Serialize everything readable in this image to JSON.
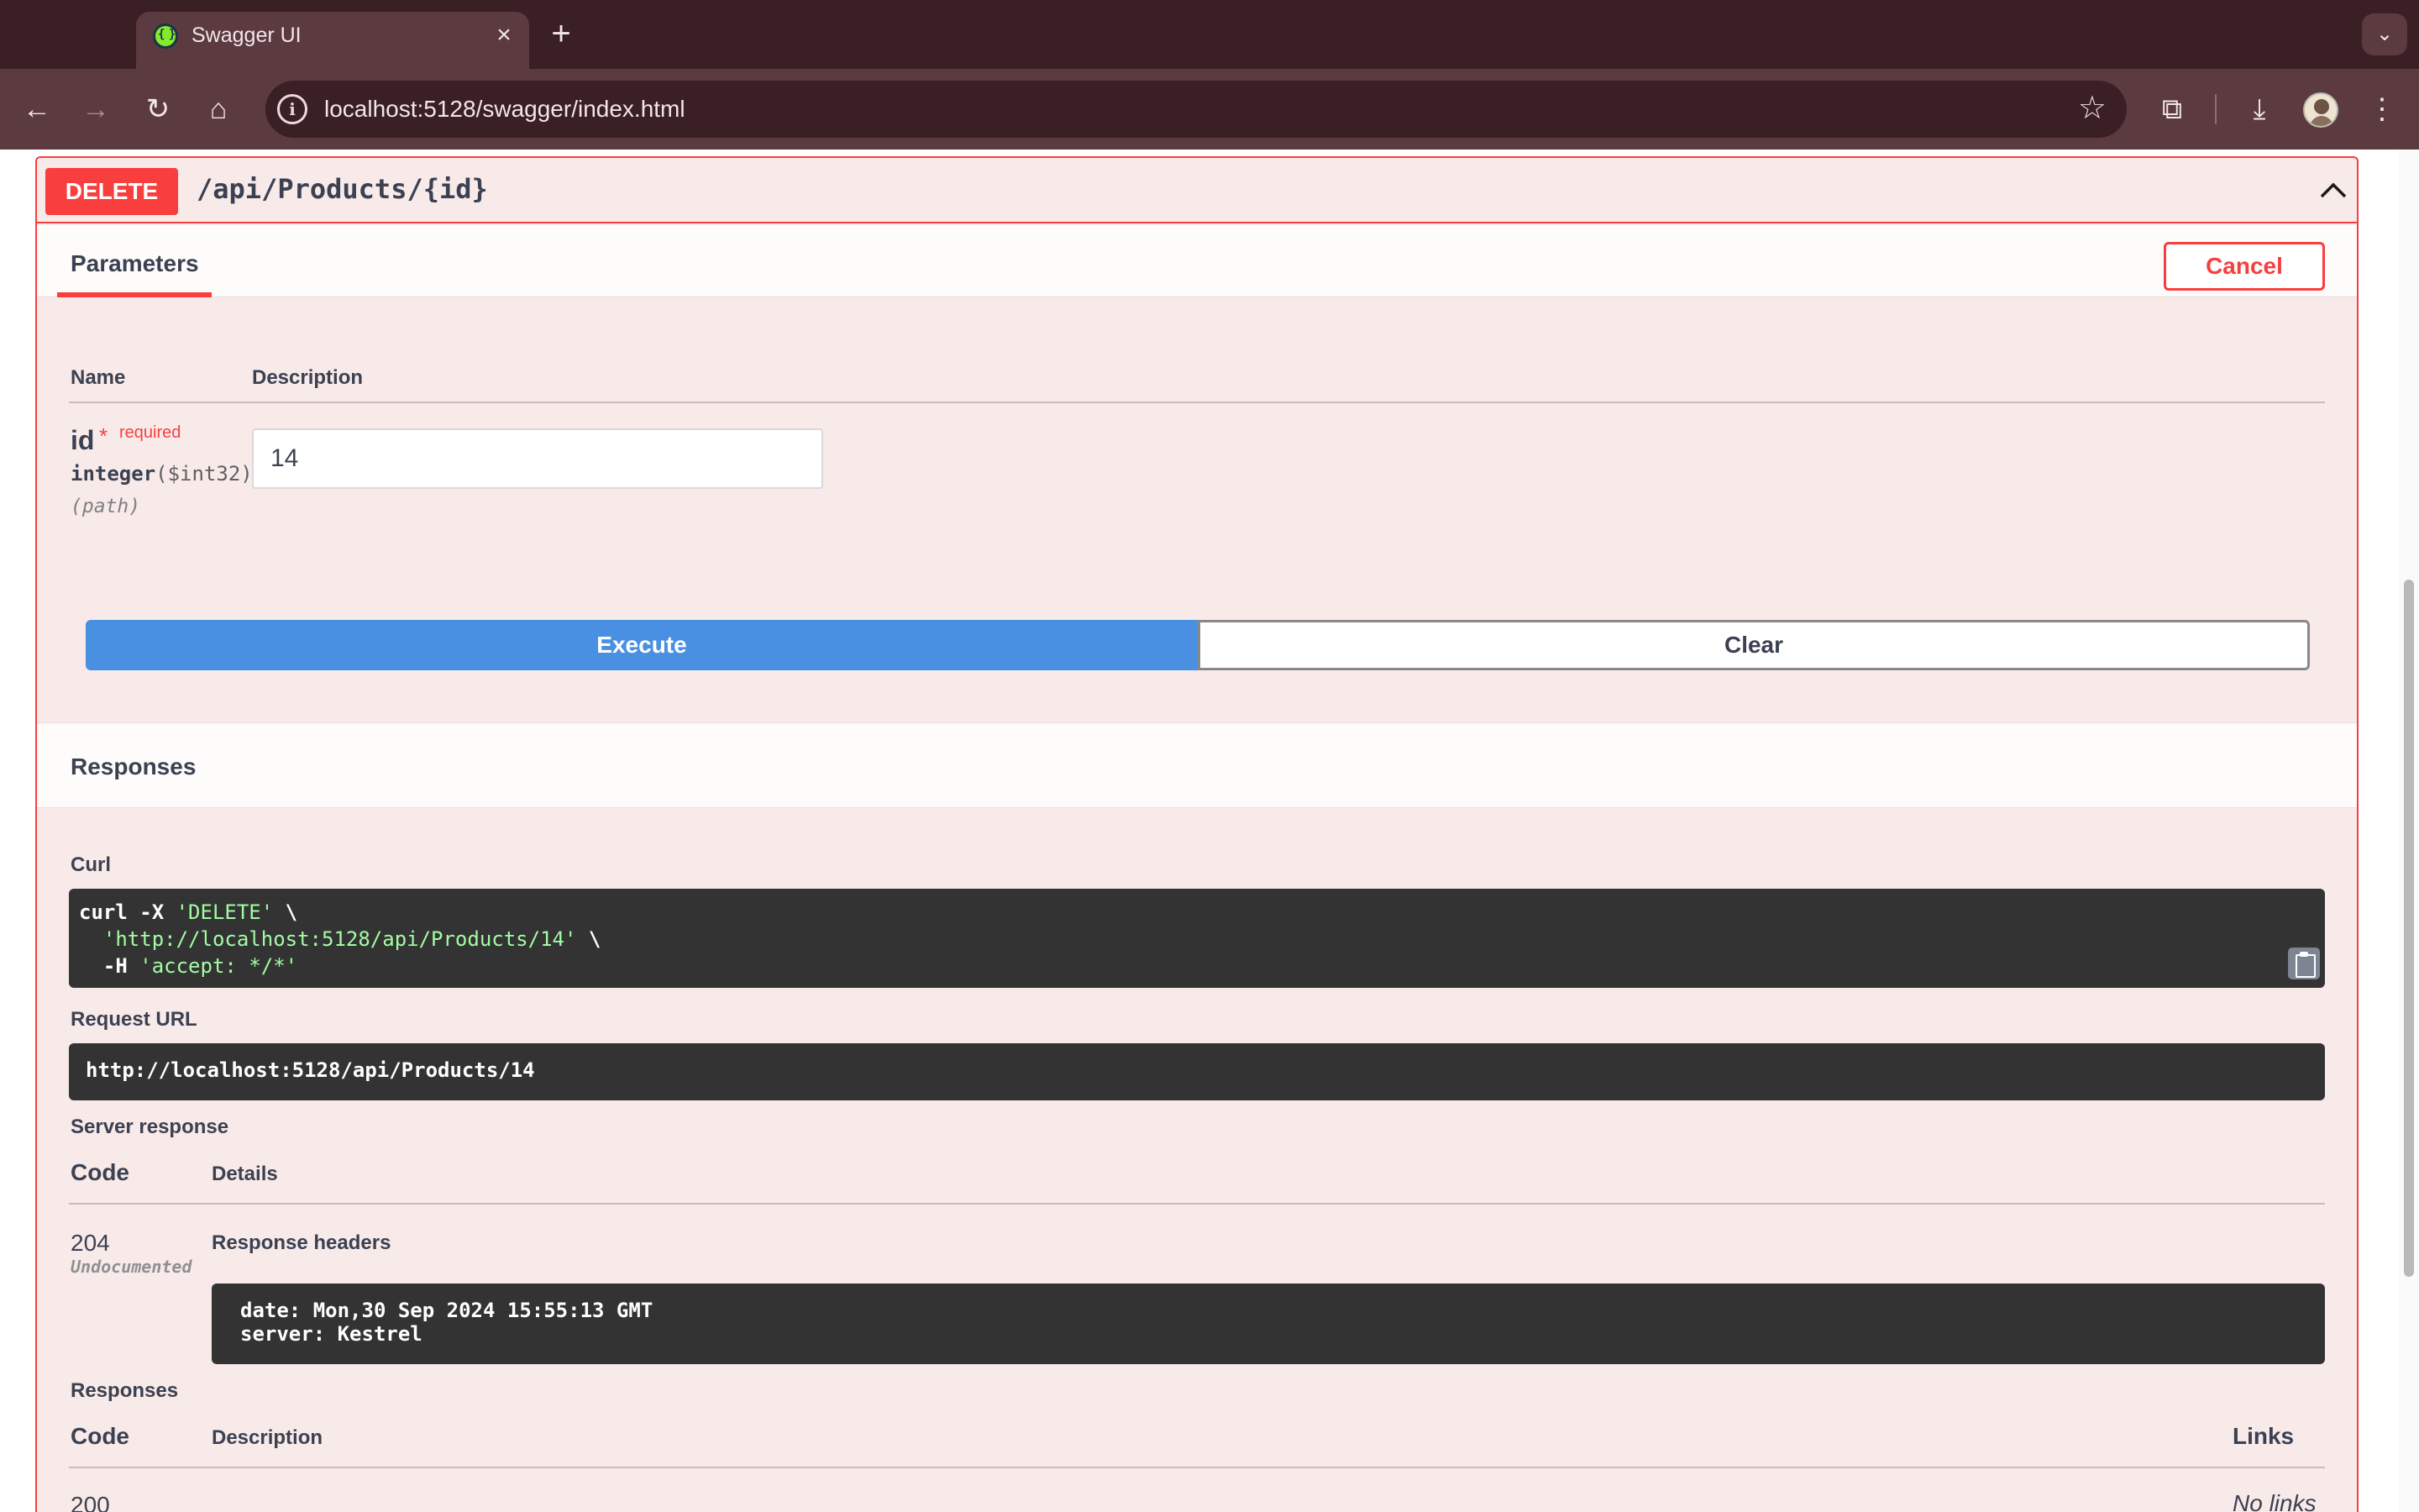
{
  "browser": {
    "tab_title": "Swagger UI",
    "url": "localhost:5128/swagger/index.html"
  },
  "operation": {
    "method": "DELETE",
    "path": "/api/Products/{id}",
    "method_color": "#f93e3e"
  },
  "parameters": {
    "tab_label": "Parameters",
    "cancel_label": "Cancel",
    "col_name": "Name",
    "col_description": "Description",
    "items": [
      {
        "name": "id",
        "required_star": "*",
        "required_label": "required",
        "type": "integer",
        "format": "($int32)",
        "in": "(path)",
        "value": "14"
      }
    ]
  },
  "actions": {
    "execute_label": "Execute",
    "clear_label": "Clear"
  },
  "responses_section": {
    "title": "Responses",
    "curl_label": "Curl",
    "curl": {
      "cmd1": "curl -X ",
      "method": "'DELETE'",
      "cont1": " \\",
      "url": "'http://localhost:5128/api/Products/14'",
      "cont2": " \\",
      "header_flag": "  -H ",
      "header_value": "'accept: */*'"
    },
    "request_url_label": "Request URL",
    "request_url": "http://localhost:5128/api/Products/14",
    "server_response_label": "Server response",
    "col_code": "Code",
    "col_details": "Details",
    "status_code": "204",
    "status_note": "Undocumented",
    "response_headers_label": "Response headers",
    "header_date": "date: Mon,30 Sep 2024 15:55:13 GMT",
    "header_server": "server: Kestrel"
  },
  "documented_responses": {
    "title": "Responses",
    "col_code": "Code",
    "col_description": "Description",
    "col_links": "Links",
    "rows": [
      {
        "code": "200",
        "links": "No links"
      }
    ]
  }
}
